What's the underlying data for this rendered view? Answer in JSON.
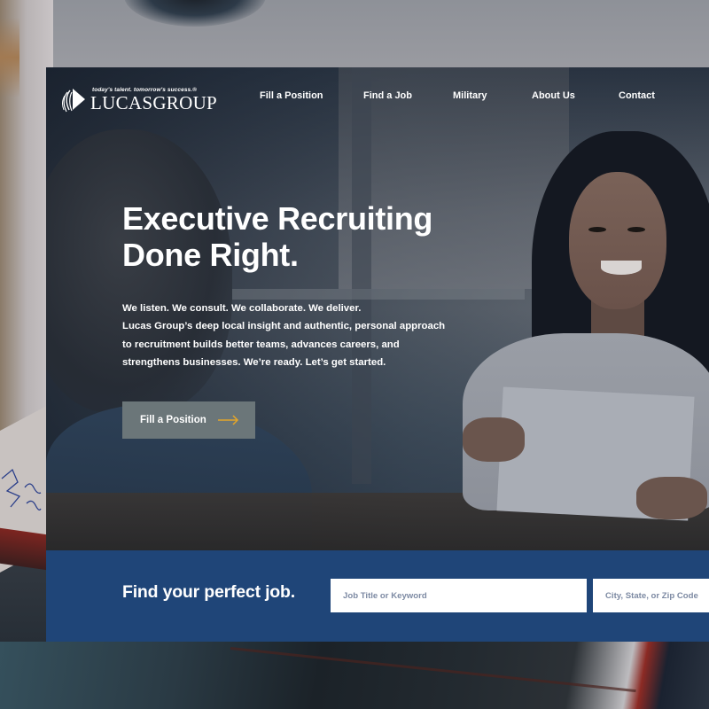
{
  "brand": {
    "name": "LUCASGROUP",
    "tagline": "today's talent. tomorrow's success.®"
  },
  "nav": {
    "items": [
      {
        "label": "Fill a Position"
      },
      {
        "label": "Find a Job"
      },
      {
        "label": "Military"
      },
      {
        "label": "About Us"
      },
      {
        "label": "Contact"
      }
    ]
  },
  "hero": {
    "title_line1": "Executive Recruiting",
    "title_line2": "Done Right.",
    "body_lines": [
      "We listen. We consult. We collaborate. We deliver.",
      "Lucas Group’s deep local insight and authentic, personal approach",
      "to recruitment builds better teams, advances careers, and",
      "strengthens businesses. We’re ready. Let’s get started."
    ],
    "cta_label": "Fill a Position",
    "cta_icon": "arrow-right-icon",
    "cta_arrow_color": "#e3a52a"
  },
  "search": {
    "title": "Find your perfect job.",
    "keyword_placeholder": "Job Title or Keyword",
    "keyword_value": "",
    "location_placeholder": "City, State, or Zip Code",
    "location_value": ""
  },
  "colors": {
    "search_band": "#1f4578",
    "cta_bg": "#6b7679",
    "placeholder": "#7d8aa3"
  }
}
